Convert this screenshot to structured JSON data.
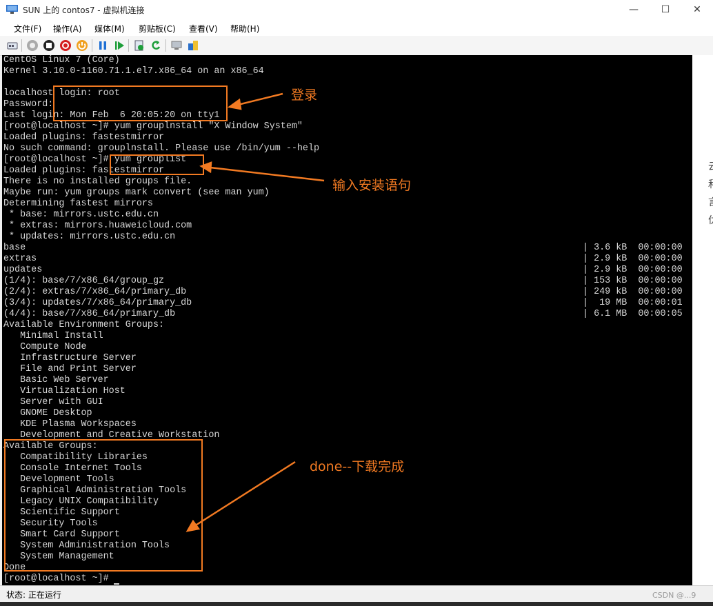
{
  "window": {
    "title": "SUN 上的 contos7 - 虚拟机连接",
    "controls": {
      "minimize": "—",
      "maximize": "☐",
      "close": "✕"
    }
  },
  "menu": [
    "文件(F)",
    "操作(A)",
    "媒体(M)",
    "剪贴板(C)",
    "查看(V)",
    "帮助(H)"
  ],
  "toolbar": {
    "buttons": [
      "ctrl-alt-del-icon",
      "start-icon",
      "turn-off-icon",
      "shutdown-icon",
      "power-icon",
      "pause-icon",
      "resume-icon",
      "checkpoint-icon",
      "revert-icon",
      "enhanced-session-icon",
      "share-icon"
    ]
  },
  "terminal": {
    "lines": [
      "CentOS Linux 7 (Core)",
      "Kernel 3.10.0-1160.71.1.el7.x86_64 on an x86_64",
      "",
      "localhost login: root",
      "Password:",
      "Last login: Mon Feb  6 20:05:20 on tty1",
      "[root@localhost ~]# yum grouplnstall \"X Window System\"",
      "Loaded plugins: fastestmirror",
      "No such command: grouplnstall. Please use /bin/yum --help",
      "[root@localhost ~]# yum grouplist",
      "Loaded plugins: fastestmirror",
      "There is no installed groups file.",
      "Maybe run: yum groups mark convert (see man yum)",
      "Determining fastest mirrors",
      " * base: mirrors.ustc.edu.cn",
      " * extras: mirrors.huaweicloud.com",
      " * updates: mirrors.ustc.edu.cn",
      "base",
      "extras",
      "updates",
      "(1/4): base/7/x86_64/group_gz",
      "(2/4): extras/7/x86_64/primary_db",
      "(3/4): updates/7/x86_64/primary_db",
      "(4/4): base/7/x86_64/primary_db",
      "Available Environment Groups:",
      "   Minimal Install",
      "   Compute Node",
      "   Infrastructure Server",
      "   File and Print Server",
      "   Basic Web Server",
      "   Virtualization Host",
      "   Server with GUI",
      "   GNOME Desktop",
      "   KDE Plasma Workspaces",
      "   Development and Creative Workstation",
      "Available Groups:",
      "   Compatibility Libraries",
      "   Console Internet Tools",
      "   Development Tools",
      "   Graphical Administration Tools",
      "   Legacy UNIX Compatibility",
      "   Scientific Support",
      "   Security Tools",
      "   Smart Card Support",
      "   System Administration Tools",
      "   System Management",
      "Done",
      "[root@localhost ~]# "
    ],
    "right_columns": [
      "| 3.6 kB  00:00:00",
      "| 2.9 kB  00:00:00",
      "| 2.9 kB  00:00:00",
      "| 153 kB  00:00:00",
      "| 249 kB  00:00:00",
      "|  19 MB  00:00:01",
      "| 6.1 MB  00:00:05"
    ]
  },
  "annotations": {
    "login": "登录",
    "install_cmd": "输入安装语句",
    "done": "done--下载完成",
    "color": "#f27a22"
  },
  "status": {
    "text": "状态: 正在运行",
    "watermark": "CSDN @...9"
  },
  "background_strip": [
    "云",
    "和",
    "言",
    "仂"
  ]
}
